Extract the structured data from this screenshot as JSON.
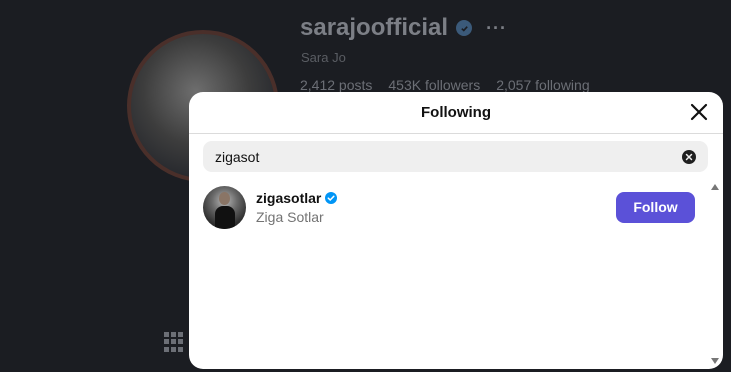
{
  "background_profile": {
    "username": "sarajoofficial",
    "full_name": "Sara Jo",
    "more_label": "···",
    "stats": {
      "posts": "2,412 posts",
      "followers": "453K followers",
      "following": "2,057 following"
    }
  },
  "modal": {
    "title": "Following",
    "close_icon": "close-icon",
    "search": {
      "value": "zigasot",
      "placeholder": "Search",
      "clear_icon": "clear-icon"
    },
    "results": [
      {
        "username": "zigasotlar",
        "full_name": "Ziga Sotlar",
        "verified": true,
        "button_label": "Follow"
      }
    ]
  },
  "colors": {
    "follow_button": "#5b51d8",
    "verified_badge": "#0095f6",
    "backdrop": "#1b1d22"
  }
}
